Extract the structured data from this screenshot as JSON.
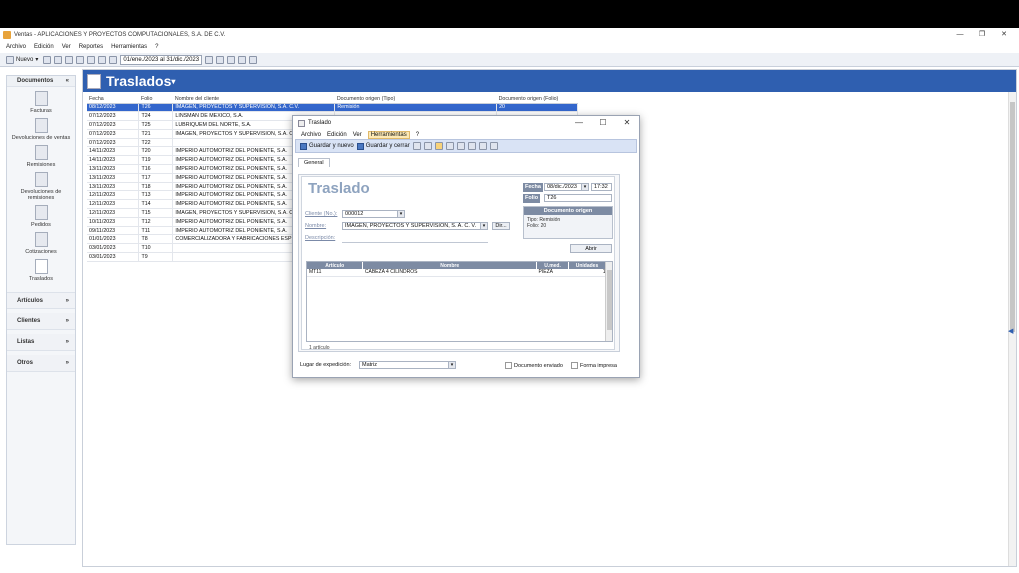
{
  "app": {
    "title": "Ventas - APLICACIONES Y PROYECTOS COMPUTACIONALES, S.A. DE C.V.",
    "window_controls": [
      "—",
      "❐",
      "✕"
    ]
  },
  "menu": [
    "Archivo",
    "Edición",
    "Ver",
    "Reportes",
    "Herramientas",
    "?"
  ],
  "toolbar": {
    "new_label": "Nuevo",
    "date_range": "01/ene./2023 al 31/dic./2023"
  },
  "sidebar": {
    "documents_header": "Documentos",
    "items": [
      {
        "label": "Facturas",
        "icon": "invoice-icon"
      },
      {
        "label": "Devoluciones de ventas",
        "icon": "sales-return-icon"
      },
      {
        "label": "Remisiones",
        "icon": "delivery-note-icon"
      },
      {
        "label": "Devoluciones de remisiones",
        "icon": "delivery-return-icon"
      },
      {
        "label": "Pedidos",
        "icon": "order-icon"
      },
      {
        "label": "Cotizaciones",
        "icon": "quote-icon"
      },
      {
        "label": "Traslados",
        "icon": "transfer-icon"
      }
    ],
    "collapsed": [
      "Artículos",
      "Clientes",
      "Listas",
      "Otros"
    ]
  },
  "main": {
    "title": "Traslados",
    "columns": [
      "Fecha",
      "Folio",
      "Nombre del cliente",
      "Documento origen (Tipo)",
      "Documento origen (Folio)"
    ],
    "rows": [
      [
        "08/12/2023",
        "T26",
        "IMAGEN, PROYECTOS Y SUPERVISION, S.A. C.V.",
        "Remisión",
        "20"
      ],
      [
        "07/12/2023",
        "T24",
        "LINSMAN DE MEXICO, S.A.",
        "",
        ""
      ],
      [
        "07/12/2023",
        "T25",
        "LUBRIQUEM DEL NORTE, S.A.",
        "",
        ""
      ],
      [
        "07/12/2023",
        "T21",
        "IMAGEN, PROYECTOS Y SUPERVISION, S.A. C.V.",
        "",
        ""
      ],
      [
        "07/12/2023",
        "T22",
        "",
        "",
        ""
      ],
      [
        "14/11/2023",
        "T20",
        "IMPERIO AUTOMOTRIZ DEL PONIENTE, S.A.",
        "",
        ""
      ],
      [
        "14/11/2023",
        "T19",
        "IMPERIO AUTOMOTRIZ DEL PONIENTE, S.A.",
        "",
        ""
      ],
      [
        "13/11/2023",
        "T16",
        "IMPERIO AUTOMOTRIZ DEL PONIENTE, S.A.",
        "",
        ""
      ],
      [
        "13/11/2023",
        "T17",
        "IMPERIO AUTOMOTRIZ DEL PONIENTE, S.A.",
        "",
        ""
      ],
      [
        "13/11/2023",
        "T18",
        "IMPERIO AUTOMOTRIZ DEL PONIENTE, S.A.",
        "",
        ""
      ],
      [
        "12/11/2023",
        "T13",
        "IMPERIO AUTOMOTRIZ DEL PONIENTE, S.A.",
        "",
        ""
      ],
      [
        "12/11/2023",
        "T14",
        "IMPERIO AUTOMOTRIZ DEL PONIENTE, S.A.",
        "",
        ""
      ],
      [
        "12/11/2023",
        "T15",
        "IMAGEN, PROYECTOS Y SUPERVISION, S.A. C.V.",
        "",
        ""
      ],
      [
        "10/11/2023",
        "T12",
        "IMPERIO AUTOMOTRIZ DEL PONIENTE, S.A.",
        "",
        ""
      ],
      [
        "09/11/2023",
        "T11",
        "IMPERIO AUTOMOTRIZ DEL PONIENTE, S.A.",
        "",
        ""
      ],
      [
        "01/01/2023",
        "T8",
        "COMERCIALIZADORA Y FABRICACIONES ESP",
        "",
        ""
      ],
      [
        "03/01/2023",
        "T10",
        "",
        "",
        ""
      ],
      [
        "03/01/2023",
        "T9",
        "",
        "",
        ""
      ]
    ]
  },
  "dialog": {
    "title": "Traslado",
    "menu": [
      "Archivo",
      "Edición",
      "Ver",
      "Herramientas",
      "?"
    ],
    "save_new": "Guardar y nuevo",
    "save_close": "Guardar y cerrar",
    "tab": "General",
    "heading": "Traslado",
    "fecha_label": "Fecha",
    "fecha_value": "08/dic./2023",
    "hora_value": "17:32",
    "folio_label": "Folio",
    "folio_value": "T26",
    "cliente_label": "Cliente (No.):",
    "cliente_value": "000012",
    "nombre_label": "Nombre:",
    "nombre_value": "IMAGEN, PROYECTOS Y SUPERVISION, S. A. C. V.",
    "dir_label": "Dir...",
    "descripcion_label": "Descripción:",
    "origen_header": "Documento origen",
    "origen_tipo": "Tipo: Remisión",
    "origen_folio": "Folio: 20",
    "abrir_label": "Abrir",
    "item_columns": [
      "Artículo",
      "Nombre",
      "U.med.",
      "Unidades"
    ],
    "items": [
      [
        "MT11",
        "CABEZA 4 CILINDROS",
        "PIEZA",
        "1"
      ]
    ],
    "count": "1 artículo",
    "lugar_label": "Lugar de expedición:",
    "lugar_value": "Matriz",
    "doc_enviado": "Documento enviado",
    "forma_impresa": "Forma impresa"
  }
}
